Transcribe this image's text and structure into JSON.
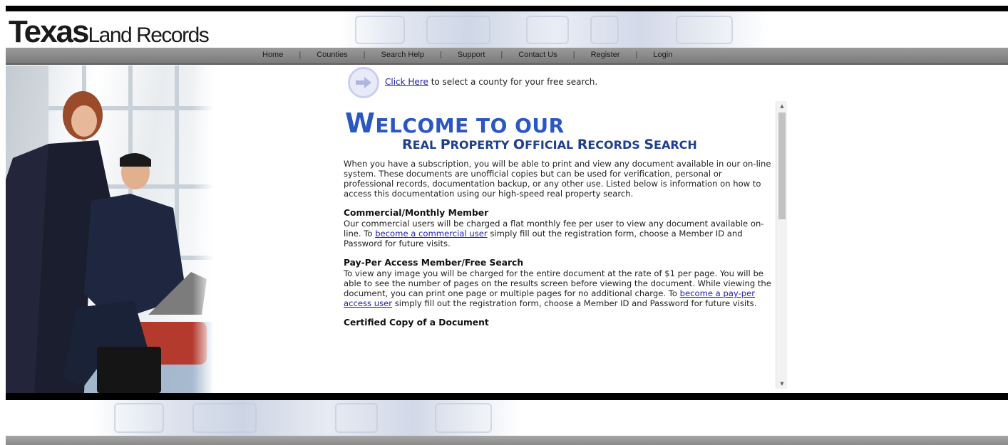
{
  "brand": {
    "logo_bold": "Texas",
    "logo_light": "Land Records"
  },
  "nav": {
    "items": [
      {
        "label": "Home"
      },
      {
        "label": "Counties"
      },
      {
        "label": "Search Help"
      },
      {
        "label": "Support"
      },
      {
        "label": "Contact Us"
      },
      {
        "label": "Register"
      },
      {
        "label": "Login"
      }
    ],
    "separator": "|"
  },
  "free_search": {
    "link_text": "Click Here",
    "rest_text": " to select a county for your free search."
  },
  "welcome": {
    "title_initial": "W",
    "title_rest": "ELCOME TO OUR",
    "subtitle_parts": [
      {
        "initial": "R",
        "rest": "EAL "
      },
      {
        "initial": "P",
        "rest": "ROPERTY "
      },
      {
        "initial": "O",
        "rest": "FFICIAL "
      },
      {
        "initial": "R",
        "rest": "ECORDS "
      },
      {
        "initial": "S",
        "rest": "EARCH"
      }
    ],
    "intro": "When you have a subscription, you will be able to print and view any document available in our on-line system. These documents are unofficial copies but can be used for verification, personal or professional records, documentation backup, or any other use. Listed below is information on how to access this documentation using our high-speed real property search."
  },
  "sections": {
    "commercial": {
      "heading": "Commercial/Monthly Member",
      "before": "Our commercial users will be charged a flat monthly fee per user to view any document available on-line. To ",
      "link": "become a commercial user",
      "after": " simply fill out the registration form, choose a Member ID and Password for future visits."
    },
    "pay_per_access": {
      "heading": "Pay-Per Access Member/Free Search",
      "before": "To view any image you will be charged for the entire document at the rate of $1 per page. You will be able to see the number of pages on the results screen before viewing the document. While viewing the document, you can print one page or multiple pages for no additional charge. To ",
      "link": "become a pay-per access user",
      "after": " simply fill out the registration form, choose a Member ID and Password for future visits."
    },
    "certified": {
      "heading": "Certified Copy of a Document"
    }
  },
  "scrollbar": {
    "up_arrow": "▲",
    "down_arrow": "▼"
  },
  "colors": {
    "title_blue": "#2b57c0",
    "link_blue": "#2222aa",
    "nav_gray": "#8a8a8a"
  }
}
